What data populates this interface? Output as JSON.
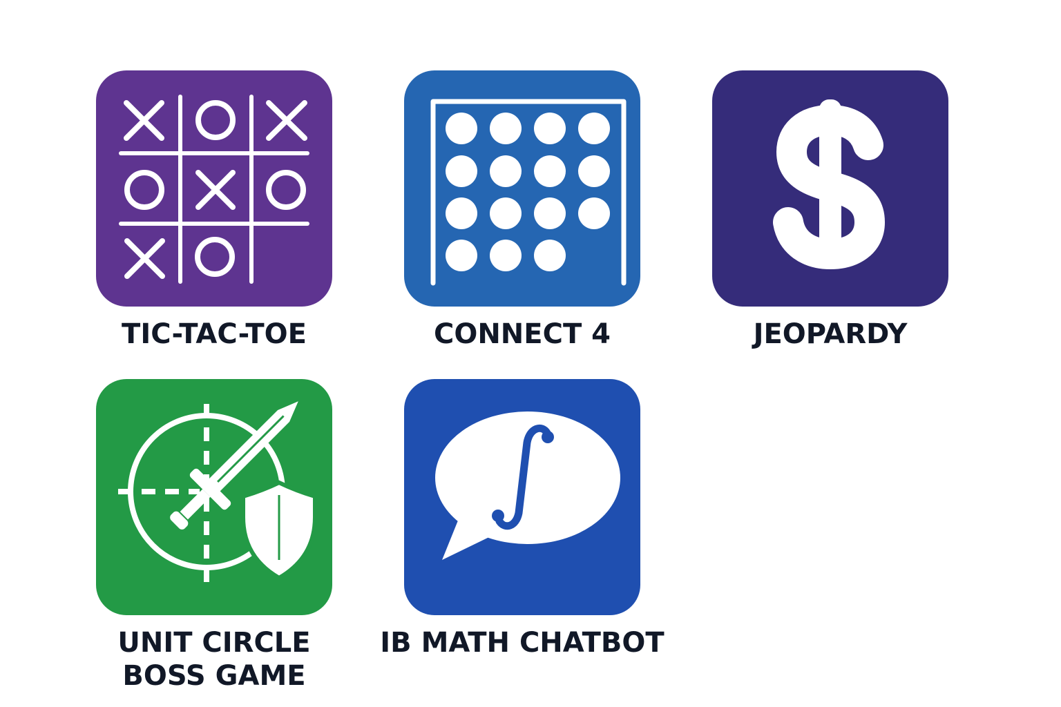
{
  "apps": [
    {
      "label": "TIC-TAC-TOE",
      "icon": "tic-tac-toe-board-icon",
      "color": "#5e3490"
    },
    {
      "label": "CONNECT 4",
      "icon": "connect-four-grid-icon",
      "color": "#2566b2"
    },
    {
      "label": "JEOPARDY",
      "icon": "dollar-sign-icon",
      "color": "#352c7a"
    },
    {
      "label": "UNIT CIRCLE\nBOSS GAME",
      "icon": "unit-circle-sword-shield-icon",
      "color": "#239a46"
    },
    {
      "label": "IB MATH CHATBOT",
      "icon": "chat-bubble-integral-icon",
      "color": "#1f4fb0"
    }
  ],
  "colors": {
    "label_text": "#111827",
    "icon_foreground": "#ffffff"
  }
}
